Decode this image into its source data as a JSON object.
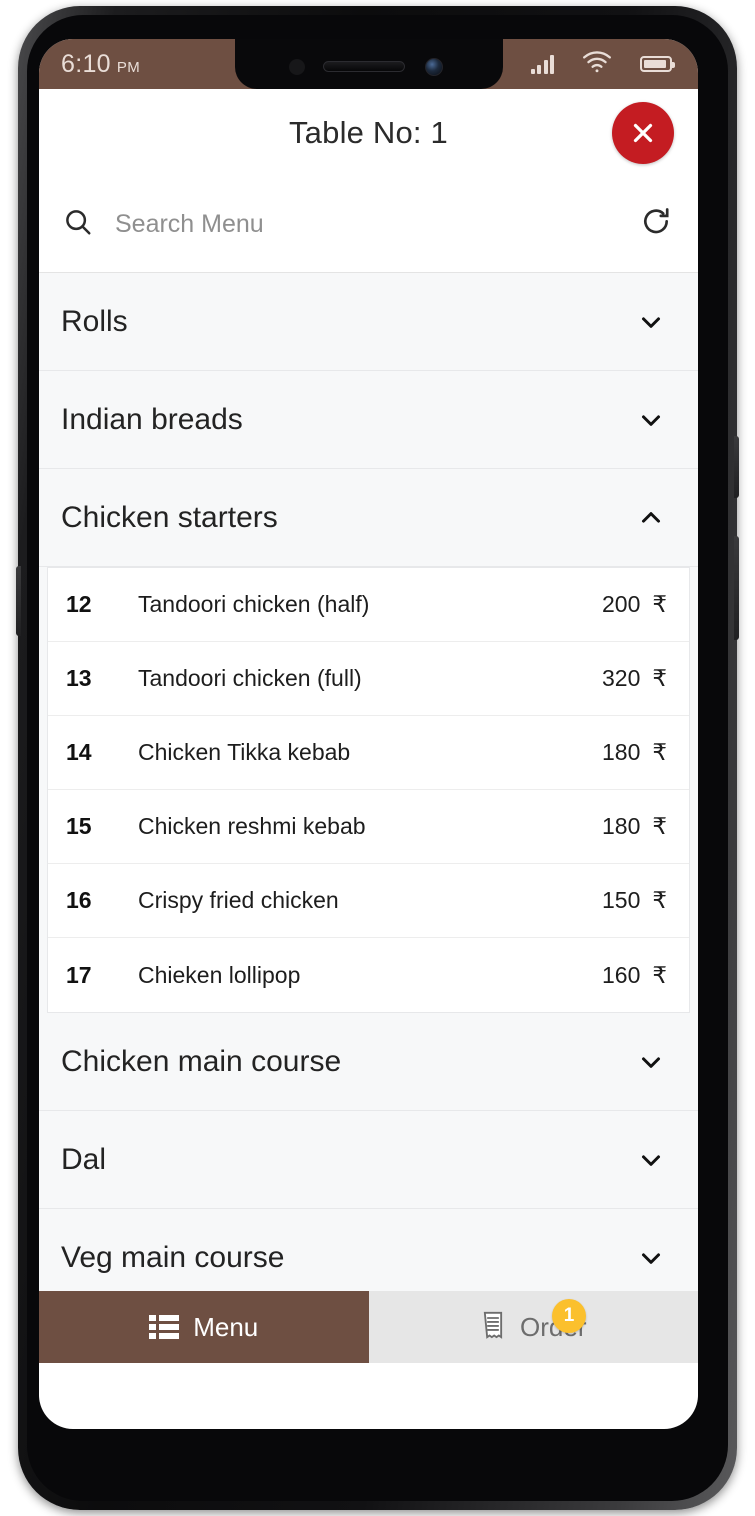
{
  "statusbar": {
    "time": "6:10",
    "ampm": "PM",
    "signal_icon": "signal-bars-icon",
    "wifi_icon": "wifi-icon",
    "battery_icon": "battery-icon"
  },
  "header": {
    "title": "Table No: 1",
    "close_icon": "close-icon"
  },
  "search": {
    "placeholder": "Search Menu",
    "value": "",
    "search_icon": "search-icon",
    "refresh_icon": "refresh-icon"
  },
  "categories": [
    {
      "label": "Rolls",
      "expanded": false,
      "chevron": "chevron-down-icon"
    },
    {
      "label": "Indian breads",
      "expanded": false,
      "chevron": "chevron-down-icon"
    },
    {
      "label": "Chicken starters",
      "expanded": true,
      "chevron": "chevron-up-icon"
    },
    {
      "label": "Chicken main course",
      "expanded": false,
      "chevron": "chevron-down-icon"
    },
    {
      "label": "Dal",
      "expanded": false,
      "chevron": "chevron-down-icon"
    },
    {
      "label": "Veg main course",
      "expanded": false,
      "chevron": "chevron-down-icon"
    }
  ],
  "menu_items": [
    {
      "no": "12",
      "name": "Tandoori chicken (half)",
      "price": "200",
      "currency": "₹"
    },
    {
      "no": "13",
      "name": "Tandoori chicken (full)",
      "price": "320",
      "currency": "₹"
    },
    {
      "no": "14",
      "name": "Chicken Tikka kebab",
      "price": "180",
      "currency": "₹"
    },
    {
      "no": "15",
      "name": "Chicken reshmi kebab",
      "price": "180",
      "currency": "₹"
    },
    {
      "no": "16",
      "name": "Crispy fried chicken",
      "price": "150",
      "currency": "₹"
    },
    {
      "no": "17",
      "name": "Chieken lollipop",
      "price": "160",
      "currency": "₹"
    }
  ],
  "bottom_nav": {
    "menu": {
      "label": "Menu",
      "icon": "list-icon",
      "active": true
    },
    "order": {
      "label": "Order",
      "icon": "receipt-icon",
      "active": false,
      "badge": "1"
    }
  },
  "colors": {
    "brand_brown": "#6e4f42",
    "close_red": "#c41c22",
    "badge_yellow": "#fbc02d",
    "nav_inactive": "#e6e6e6",
    "panel_bg": "#f7f8f9"
  }
}
